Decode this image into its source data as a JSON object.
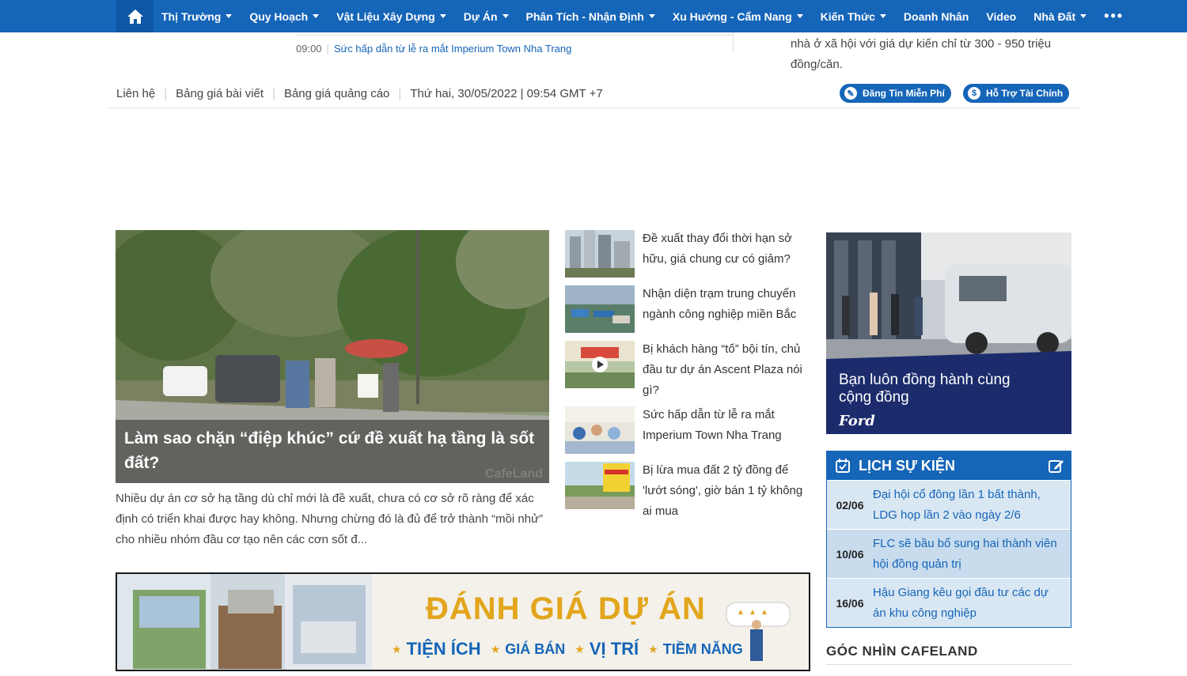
{
  "nav": {
    "items": [
      {
        "label": "Thị Trường",
        "caret": true
      },
      {
        "label": "Quy Hoạch",
        "caret": true
      },
      {
        "label": "Vật Liệu Xây Dựng",
        "caret": true
      },
      {
        "label": "Dự Án",
        "caret": true
      },
      {
        "label": "Phân Tích - Nhận Định",
        "caret": true
      },
      {
        "label": "Xu Hướng - Cẩm Nang",
        "caret": true
      },
      {
        "label": "Kiến Thức",
        "caret": true
      },
      {
        "label": "Doanh Nhân",
        "caret": false
      },
      {
        "label": "Video",
        "caret": false
      },
      {
        "label": "Nhà Đất",
        "caret": true
      }
    ],
    "more": "•••",
    "color": "#1565b8"
  },
  "ticker": {
    "time": "09:00",
    "text": "Sức hấp dẫn từ lễ ra mắt Imperium Town Nha Trang"
  },
  "top_right_text": "nhà ở xã hội với giá dự kiến chỉ từ 300 - 950 triệu đồng/căn.",
  "utility": {
    "links": [
      "Liên hệ",
      "Bảng giá bài viết",
      "Bảng giá quảng cáo"
    ],
    "datetime": "Thứ hai, 30/05/2022 | 09:54 GMT +7"
  },
  "buttons": {
    "post_free": "Đăng Tin Miễn Phí",
    "finance": "Hỗ Trợ Tài Chính"
  },
  "hero": {
    "title": "Làm sao chặn “điệp khúc” cứ đề xuất hạ tầng là sốt đất?",
    "summary": "Nhiều dự án cơ sở hạ tầng dù chỉ mới là đề xuất, chưa có cơ sở rõ ràng để xác định có triển khai được hay không. Nhưng chừng đó là đủ để trở thành “mồi nhử” cho nhiều nhóm đầu cơ tạo nên các cơn sốt đ...",
    "watermark": "CafeLand"
  },
  "news_list": [
    {
      "title": "Đề xuất thay đổi thời hạn sở hữu, giá chung cư có giảm?",
      "video": false
    },
    {
      "title": "Nhận diện trạm trung chuyển ngành công nghiệp miền Bắc",
      "video": false
    },
    {
      "title": "Bị khách hàng “tố” bội tín, chủ đầu tư dự án Ascent Plaza nói gì?",
      "video": true
    },
    {
      "title": "Sức hấp dẫn từ lễ ra mắt Imperium Town Nha Trang",
      "video": false
    },
    {
      "title": "Bị lừa mua đất 2 tỷ đồng để 'lướt sóng', giờ bán 1 tỷ không ai mua",
      "video": false
    }
  ],
  "ford_ad": {
    "slogan": "Bạn luôn đồng hành cùng cộng đồng",
    "brand": "Ford"
  },
  "events": {
    "title": "LỊCH SỰ KIỆN",
    "rows": [
      {
        "date": "02/06",
        "title": "Đại hội cổ đông lần 1 bất thành, LDG họp lần 2 vào ngày 2/6"
      },
      {
        "date": "10/06",
        "title": "FLC sẽ bầu bổ sung hai thành viên hội đồng quản trị"
      },
      {
        "date": "16/06",
        "title": "Hậu Giang kêu gọi đầu tư các dự án khu công nghiệp"
      }
    ]
  },
  "section_title": "GÓC NHÌN CAFELAND",
  "banner": {
    "headline": "ĐÁNH GIÁ DỰ ÁN",
    "subs": [
      "TIỆN ÍCH",
      "GIÁ BÁN",
      "VỊ TRÍ",
      "TIỀM NĂNG"
    ]
  }
}
